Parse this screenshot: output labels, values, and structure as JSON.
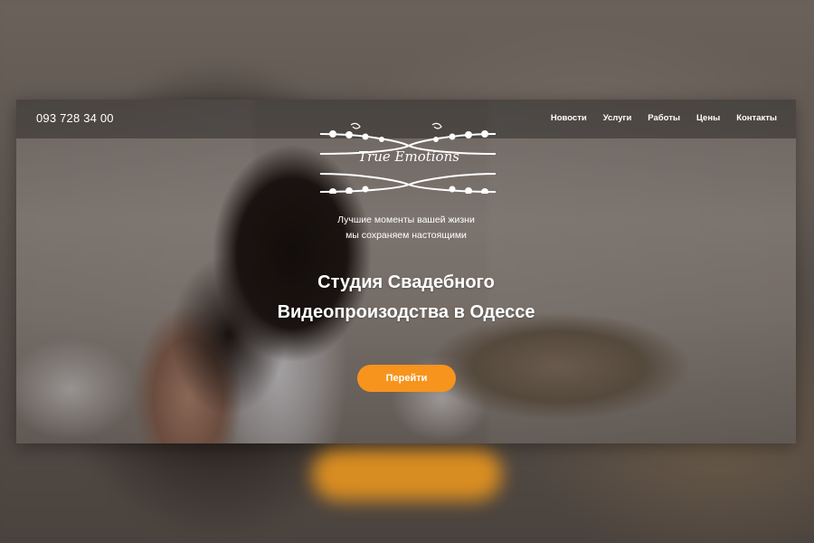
{
  "header": {
    "phone": "093 728 34 00",
    "menu": [
      {
        "label": "Новости"
      },
      {
        "label": "Услуги"
      },
      {
        "label": "Работы"
      },
      {
        "label": "Цены"
      },
      {
        "label": "Контакты"
      }
    ]
  },
  "logo": {
    "text": "True Emotions",
    "icon": "ornament-flourish-icon"
  },
  "hero": {
    "tagline_line1": "Лучшие моменты вашей жизни",
    "tagline_line2": "мы сохраняем настоящими",
    "headline_line1": "Студия Свадебного",
    "headline_line2": "Видеопроизодства в Одессе",
    "cta_label": "Перейти"
  },
  "colors": {
    "accent": "#f7941d",
    "nav_background": "rgba(0,0,0,0.32)",
    "text": "#ffffff"
  }
}
